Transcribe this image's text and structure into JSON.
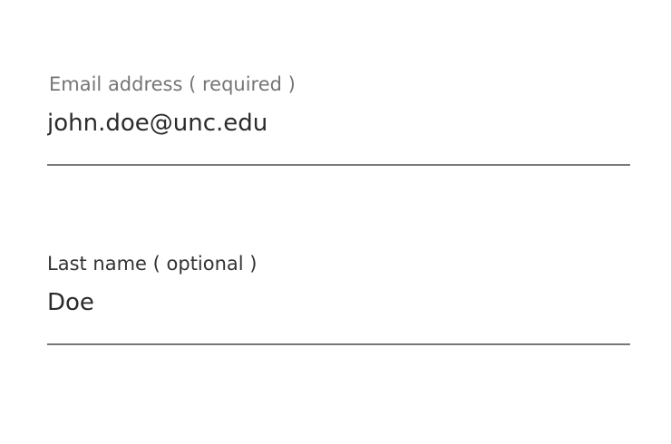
{
  "form": {
    "email": {
      "label": "Email address ( required )",
      "value": "john.doe@unc.edu"
    },
    "last_name": {
      "label": "Last name ( optional )",
      "value": "Doe"
    }
  }
}
